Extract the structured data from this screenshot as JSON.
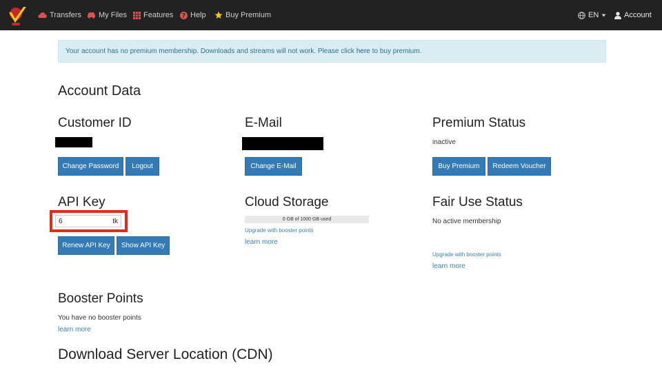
{
  "nav": {
    "items": [
      {
        "label": "Transfers",
        "icon": "cloud-icon"
      },
      {
        "label": "My Files",
        "icon": "car-icon"
      },
      {
        "label": "Features",
        "icon": "grid-icon"
      },
      {
        "label": "Help",
        "icon": "question-icon"
      },
      {
        "label": "Buy Premium",
        "icon": "star-icon"
      }
    ],
    "language": "EN",
    "account": "Account",
    "colors": {
      "bar": "#222222",
      "icon_red": "#d9534f",
      "star": "#f5c518"
    }
  },
  "alert": {
    "text_before": "Your account has no premium membership. Downloads and streams will not work. Please click",
    "link": "here",
    "text_after": "to buy premium."
  },
  "page_title": "Account Data",
  "customer": {
    "heading": "Customer ID",
    "buttons": {
      "change_password": "Change Password",
      "logout": "Logout"
    }
  },
  "email": {
    "heading": "E-Mail",
    "button": "Change E-Mail"
  },
  "premium": {
    "heading": "Premium Status",
    "status": "inactive",
    "buttons": {
      "buy": "Buy Premium",
      "redeem": "Redeem Voucher"
    }
  },
  "api": {
    "heading": "API Key",
    "value_start": "6",
    "value_end": "tk",
    "buttons": {
      "renew": "Renew API Key",
      "show": "Show API Key"
    },
    "highlight_color": "#e02b1a"
  },
  "cloud": {
    "heading": "Cloud Storage",
    "usage": "0 GB of 1000 GB used",
    "used_fraction": 0,
    "upgrade": "Upgrade with booster points",
    "learn_more": "learn more"
  },
  "fair_use": {
    "heading": "Fair Use Status",
    "status": "No active membership",
    "upgrade": "Upgrade with booster points",
    "learn_more": "learn more"
  },
  "booster": {
    "heading": "Booster Points",
    "text": "You have no booster points",
    "learn_more": "learn more"
  },
  "cdn": {
    "heading": "Download Server Location (CDN)"
  },
  "accent": "#337ab7"
}
